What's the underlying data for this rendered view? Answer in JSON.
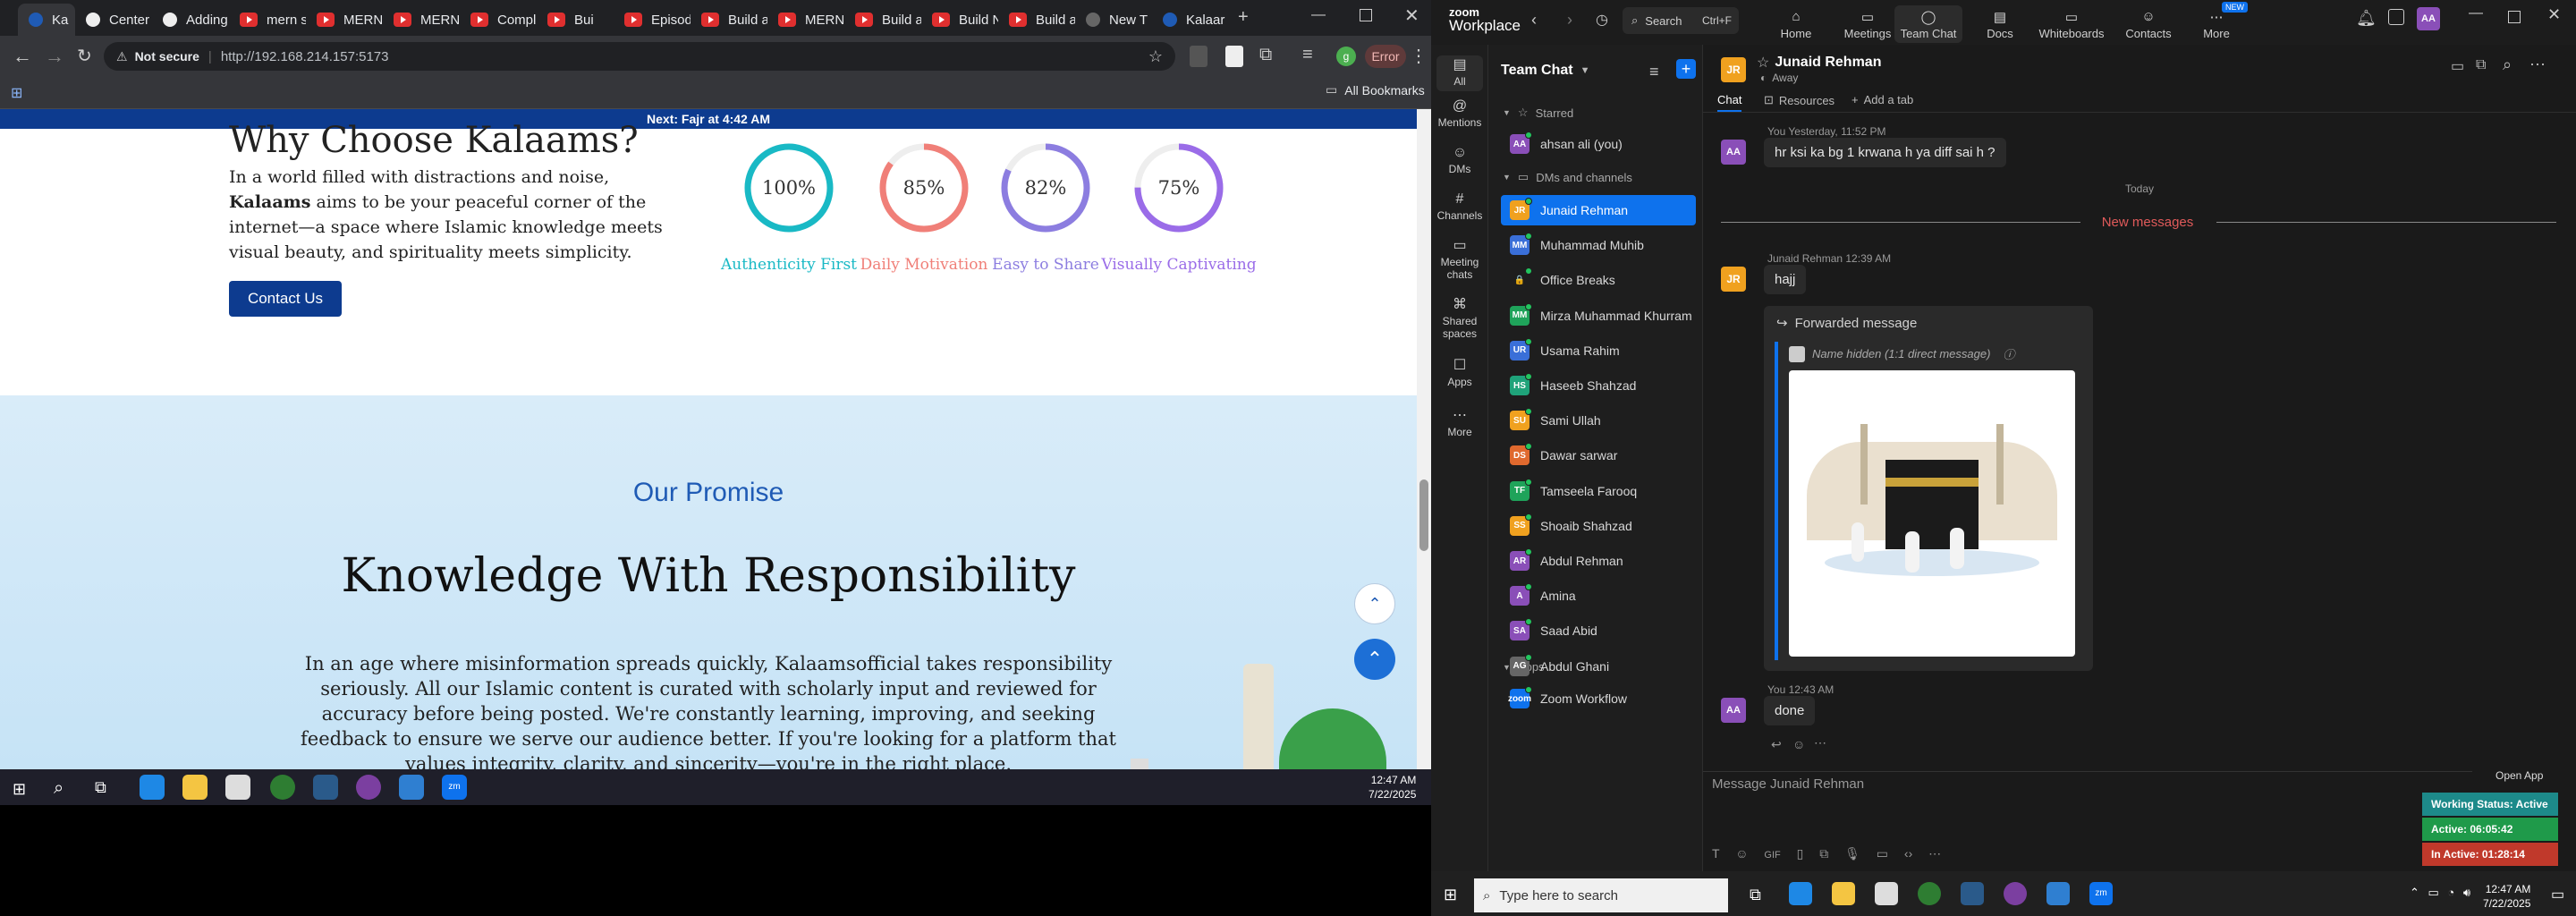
{
  "browser": {
    "tabs": [
      {
        "label": "Ka",
        "icon": "kalaams",
        "active": true
      },
      {
        "label": "Center",
        "icon": "github"
      },
      {
        "label": "Adding",
        "icon": "github"
      },
      {
        "label": "mern s",
        "icon": "youtube"
      },
      {
        "label": "MERN",
        "icon": "youtube"
      },
      {
        "label": "MERN",
        "icon": "youtube"
      },
      {
        "label": "Compl",
        "icon": "youtube"
      },
      {
        "label": "Bui",
        "icon": "youtube"
      },
      {
        "label": "Episod",
        "icon": "youtube"
      },
      {
        "label": "Build a",
        "icon": "youtube"
      },
      {
        "label": "MERN",
        "icon": "youtube"
      },
      {
        "label": "Build a",
        "icon": "youtube"
      },
      {
        "label": "Build N",
        "icon": "youtube"
      },
      {
        "label": "Build a",
        "icon": "youtube"
      },
      {
        "label": "New T",
        "icon": "chrome"
      },
      {
        "label": "Kalaar",
        "icon": "kalaams"
      }
    ],
    "security_label": "Not secure",
    "url": "http://192.168.214.157:5173",
    "error_button": "Error",
    "all_bookmarks": "All Bookmarks"
  },
  "site": {
    "prayer_bar": "Next: Fajr at 4:42 AM",
    "why_heading": "Why Choose Kalaams?",
    "why_p1": "In a world filled with distractions and noise,",
    "why_brand": "Kalaams",
    "why_p2": " aims to be your peaceful corner of the",
    "why_p3": "internet—a space where Islamic knowledge meets",
    "why_p4": "visual beauty, and spirituality meets simplicity.",
    "contact_button": "Contact Us",
    "stats": [
      {
        "value": "100%",
        "label": "Authenticity First",
        "color": "#19b9c5",
        "pct": 100
      },
      {
        "value": "85%",
        "label": "Daily Motivation",
        "color": "#f07f78",
        "pct": 85
      },
      {
        "value": "82%",
        "label": "Easy to Share",
        "color": "#8c7de0",
        "pct": 82
      },
      {
        "value": "75%",
        "label": "Visually Captivating",
        "color": "#9a6ce8",
        "pct": 75
      }
    ],
    "promise_title": "Our Promise",
    "knowledge_heading": "Knowledge With Responsibility",
    "knowledge_lines": [
      "In an age where misinformation spreads quickly, Kalaamsofficial takes responsibility",
      "seriously. All our Islamic content is curated with scholarly input and reviewed for",
      "accuracy before being posted. We're constantly learning, improving, and seeking",
      "feedback to ensure we serve our audience better. If you're looking for a platform that",
      "values integrity, clarity, and sincerity—you're in the right place."
    ]
  },
  "left_taskbar": {
    "time": "12:47 AM",
    "date": "7/22/2025"
  },
  "zoom": {
    "brand_top": "zoom",
    "brand_bottom": "Workplace",
    "search_label": "Search",
    "search_shortcut": "Ctrl+F",
    "nav": [
      {
        "label": "Home",
        "icon": "home-icon"
      },
      {
        "label": "Meetings",
        "icon": "meetings-icon"
      },
      {
        "label": "Team Chat",
        "icon": "chat-icon",
        "active": true
      },
      {
        "label": "Docs",
        "icon": "docs-icon"
      },
      {
        "label": "Whiteboards",
        "icon": "whiteboard-icon"
      },
      {
        "label": "Contacts",
        "icon": "contacts-icon"
      },
      {
        "label": "More",
        "icon": "more-icon",
        "badge": "NEW"
      }
    ],
    "user_initials": "AA",
    "rail": [
      {
        "label": "All",
        "icon": "all-icon"
      },
      {
        "label": "Mentions",
        "icon": "at-icon"
      },
      {
        "label": "DMs",
        "icon": "dms-icon"
      },
      {
        "label": "Channels",
        "icon": "hash-icon"
      },
      {
        "label": "Meeting chats",
        "icon": "meeting-chat-icon"
      },
      {
        "label": "Shared spaces",
        "icon": "shared-spaces-icon"
      },
      {
        "label": "Apps",
        "icon": "apps-icon"
      },
      {
        "label": "More",
        "icon": "more-icon"
      }
    ],
    "list_title": "Team Chat",
    "starred_header": "Starred",
    "starred": [
      {
        "name": "ahsan ali (you)",
        "initials": "AA",
        "color": "#8a4fb8"
      }
    ],
    "dms_header": "DMs and channels",
    "contacts": [
      {
        "name": "Junaid Rehman",
        "initials": "JR",
        "color": "#f0a11f"
      },
      {
        "name": "Muhammad Muhib",
        "initials": "MM",
        "color": "#3a6fd8"
      },
      {
        "name": "Office Breaks",
        "initials": "🔒",
        "color": "#1e1e1e"
      },
      {
        "name": "Mirza Muhammad Khurram",
        "initials": "MM",
        "color": "#1fa35a"
      },
      {
        "name": "Usama Rahim",
        "initials": "UR",
        "color": "#3a6fd8"
      },
      {
        "name": "Haseeb Shahzad",
        "initials": "HS",
        "color": "#1fa37a"
      },
      {
        "name": "Sami Ullah",
        "initials": "SU",
        "color": "#f0a11f"
      },
      {
        "name": "Dawar sarwar",
        "initials": "DS",
        "color": "#e0692e"
      },
      {
        "name": "Tamseela Farooq",
        "initials": "TF",
        "color": "#1fa35a"
      },
      {
        "name": "Shoaib Shahzad",
        "initials": "SS",
        "color": "#f0a11f"
      },
      {
        "name": "Abdul Rehman",
        "initials": "AR",
        "color": "#8a4fb8"
      },
      {
        "name": "Amina",
        "initials": "A",
        "color": "#8a4fb8"
      },
      {
        "name": "Saad Abid",
        "initials": "SA",
        "color": "#8a4fb8"
      },
      {
        "name": "Abdul Ghani",
        "initials": "AG",
        "color": "#666666"
      }
    ],
    "apps_header": "Apps",
    "apps": [
      {
        "name": "Zoom Workflow",
        "initials": "zoom",
        "color": "#0e72ed"
      }
    ],
    "chat_header": {
      "name": "Junaid Rehman",
      "status": "Away",
      "initials": "JR"
    },
    "chat_tabs": {
      "chat": "Chat",
      "resources": "Resources",
      "add_tab": "Add a tab"
    },
    "messages": {
      "m1_meta": "You Yesterday, 11:52 PM",
      "m1_text": "hr ksi ka bg 1 krwana h ya diff sai h ?",
      "today_divider": "Today",
      "new_messages": "New messages",
      "m2_meta": "Junaid Rehman 12:39 AM",
      "m2_text": "hajj",
      "forwarded_label": "Forwarded message",
      "forwarded_source": "Name hidden (1:1 direct message)",
      "m3_meta": "You 12:43 AM",
      "m3_text": "done"
    },
    "composer_placeholder": "Message Junaid Rehman",
    "open_app": "Open App",
    "status_widget": {
      "working": "Working Status: Active",
      "active": "Active: 06:05:42",
      "inactive": "In Active: 01:28:14",
      "colors": {
        "working": "#1d8a8a",
        "active": "#1f9a4a",
        "inactive": "#c0392b"
      }
    }
  },
  "right_taskbar": {
    "search_placeholder": "Type here to search",
    "time": "12:47 AM",
    "date": "7/22/2025"
  }
}
